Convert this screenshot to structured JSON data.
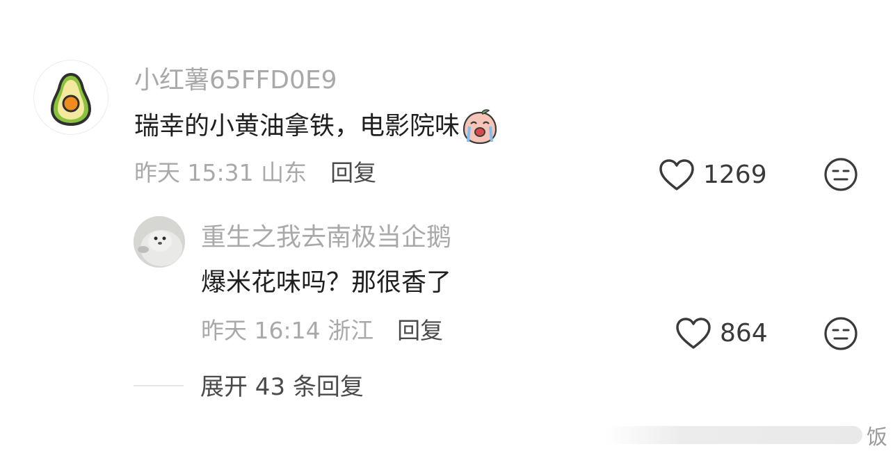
{
  "comment": {
    "username": "小红薯65FFD0E9",
    "avatar_icon": "avocado-icon",
    "text": "瑞幸的小黄油拿铁，电影院味",
    "emoji": "crying-peach-emoji",
    "time_location": "昨天 15:31 山东",
    "reply_label": "回复",
    "like_count": "1269"
  },
  "reply": {
    "username": "重生之我去南极当企鹅",
    "avatar_icon": "seal-avatar",
    "text": "爆米花味吗？那很香了",
    "time_location": "昨天 16:14 浙江",
    "reply_label": "回复",
    "like_count": "864"
  },
  "expand": {
    "label": "展开 43 条回复"
  },
  "watermark": {
    "text": "饭"
  }
}
